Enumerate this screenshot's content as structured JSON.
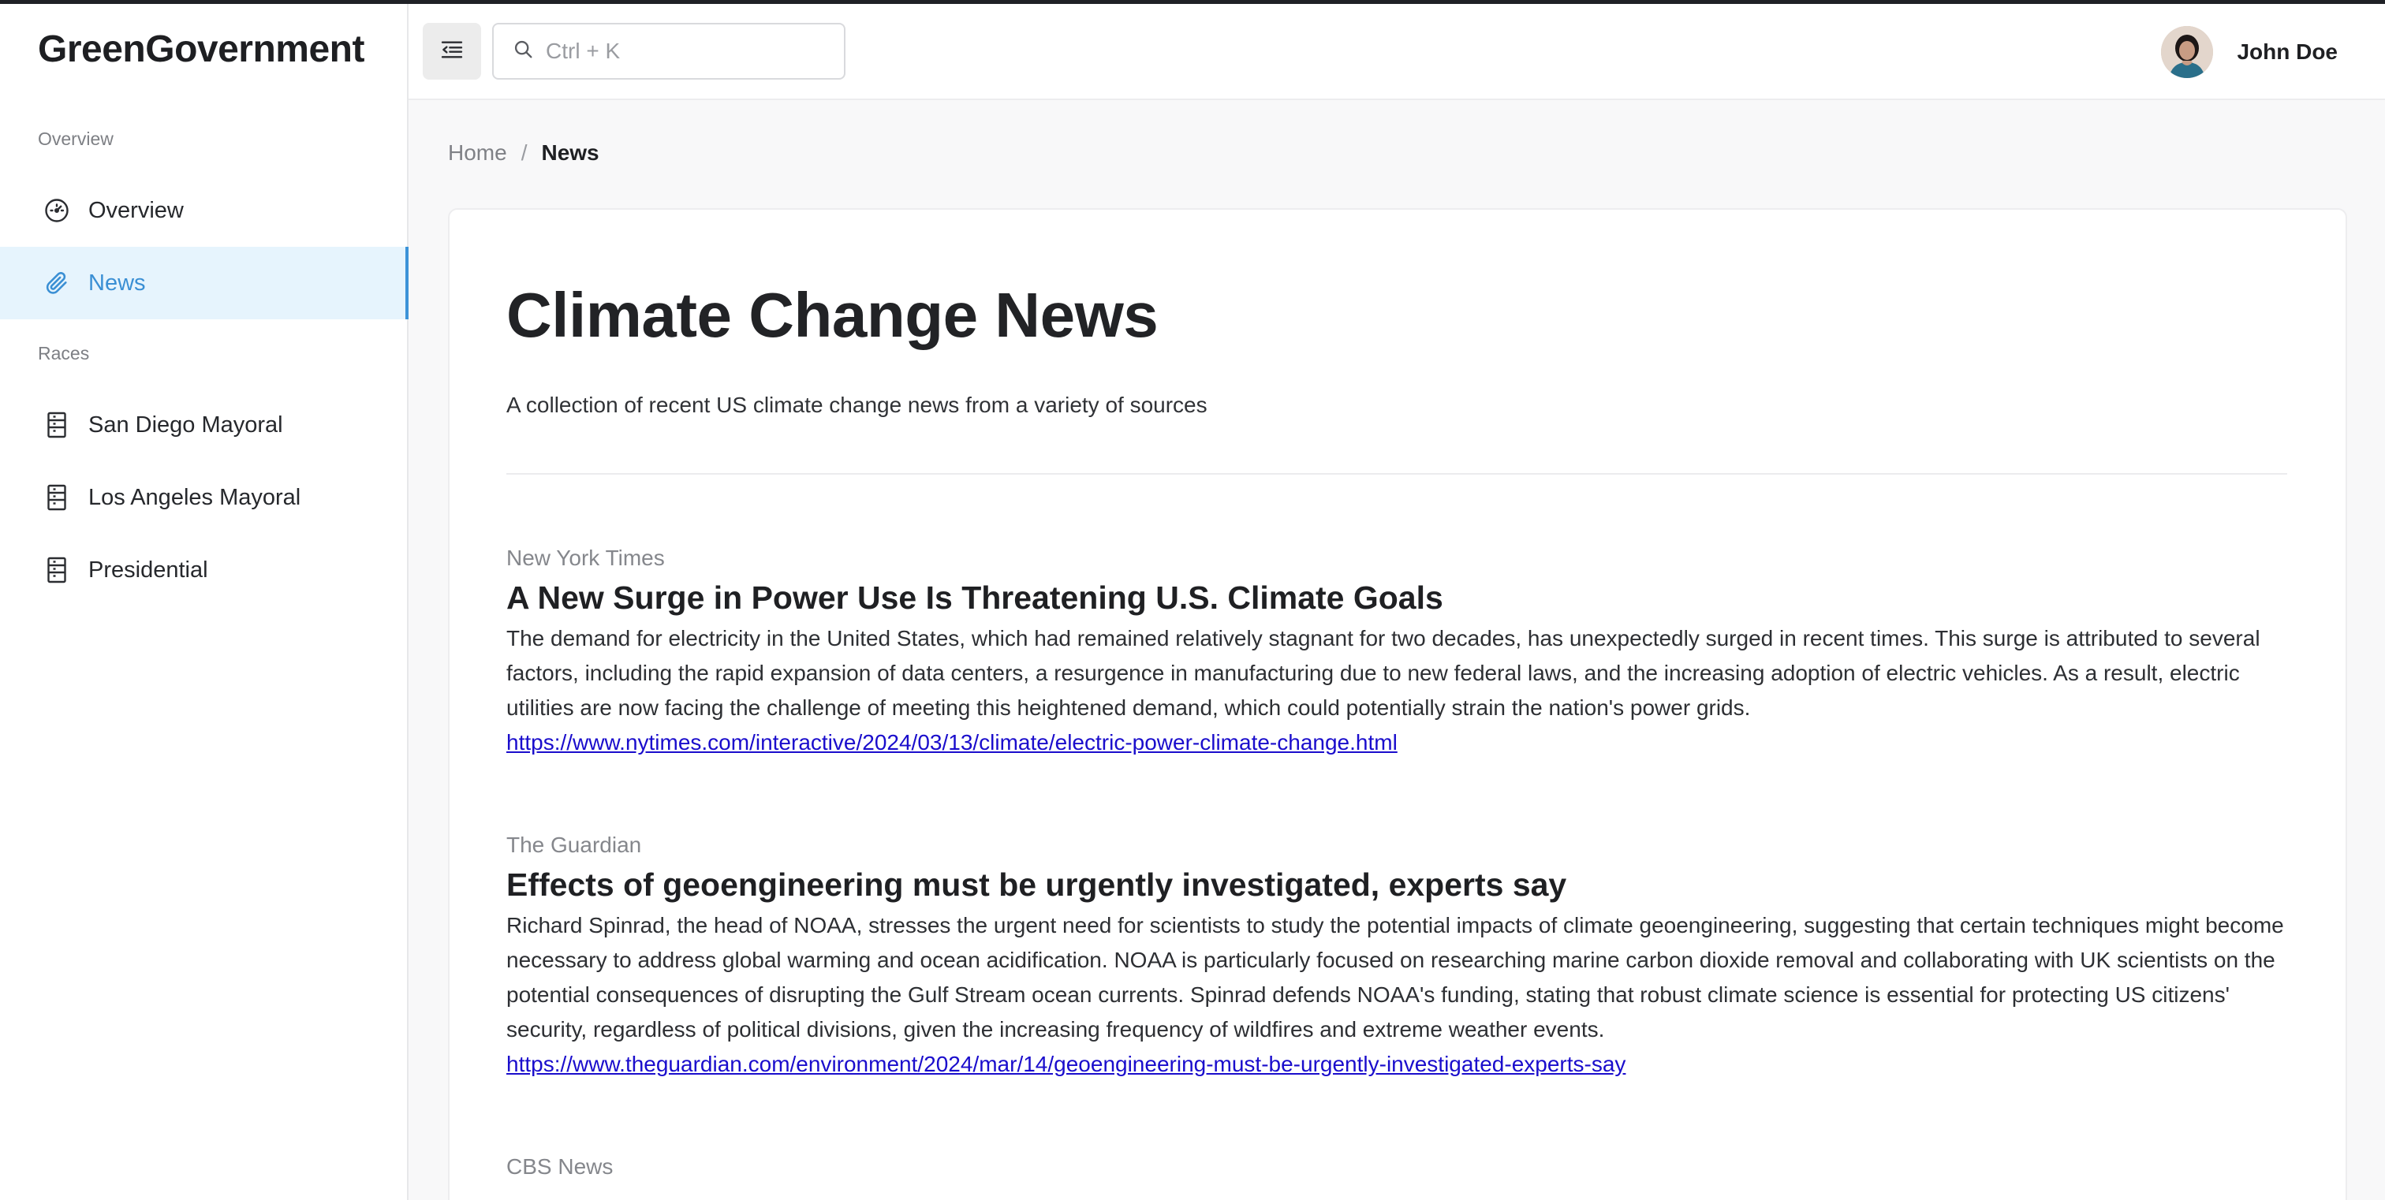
{
  "app": {
    "brand": "GreenGovernment"
  },
  "sidebar": {
    "sections": [
      {
        "label": "Overview",
        "items": [
          {
            "label": "Overview",
            "icon": "dashboard-gauge-icon"
          },
          {
            "label": "News",
            "icon": "paperclip-icon",
            "active": true
          }
        ]
      },
      {
        "label": "Races",
        "items": [
          {
            "label": "San Diego Mayoral",
            "icon": "building-icon"
          },
          {
            "label": "Los Angeles Mayoral",
            "icon": "building-icon"
          },
          {
            "label": "Presidential",
            "icon": "building-icon"
          }
        ]
      }
    ]
  },
  "header": {
    "search_placeholder": "Ctrl + K",
    "user_name": "John Doe"
  },
  "breadcrumb": {
    "home": "Home",
    "separator": "/",
    "current": "News"
  },
  "main": {
    "title": "Climate Change News",
    "description": "A collection of recent US climate change news from a variety of sources",
    "articles": [
      {
        "source": "New York Times",
        "headline": "A New Surge in Power Use Is Threatening U.S. Climate Goals",
        "summary": "The demand for electricity in the United States, which had remained relatively stagnant for two decades, has unexpectedly surged in recent times. This surge is attributed to several factors, including the rapid expansion of data centers, a resurgence in manufacturing due to new federal laws, and the increasing adoption of electric vehicles. As a result, electric utilities are now facing the challenge of meeting this heightened demand, which could potentially strain the nation's power grids.",
        "url": "https://www.nytimes.com/interactive/2024/03/13/climate/electric-power-climate-change.html"
      },
      {
        "source": "The Guardian",
        "headline": "Effects of geoengineering must be urgently investigated, experts say",
        "summary": "Richard Spinrad, the head of NOAA, stresses the urgent need for scientists to study the potential impacts of climate geoengineering, suggesting that certain techniques might become necessary to address global warming and ocean acidification. NOAA is particularly focused on researching marine carbon dioxide removal and collaborating with UK scientists on the potential consequences of disrupting the Gulf Stream ocean currents. Spinrad defends NOAA's funding, stating that robust climate science is essential for protecting US citizens' security, regardless of political divisions, given the increasing frequency of wildfires and extreme weather events.",
        "url": "https://www.theguardian.com/environment/2024/mar/14/geoengineering-must-be-urgently-investigated-experts-say"
      },
      {
        "source": "CBS News",
        "headline": "",
        "summary": "",
        "url": ""
      }
    ]
  },
  "colors": {
    "accent": "#3a8fd4",
    "active_bg": "#e6f4fd",
    "link": "#1a0dcc"
  }
}
